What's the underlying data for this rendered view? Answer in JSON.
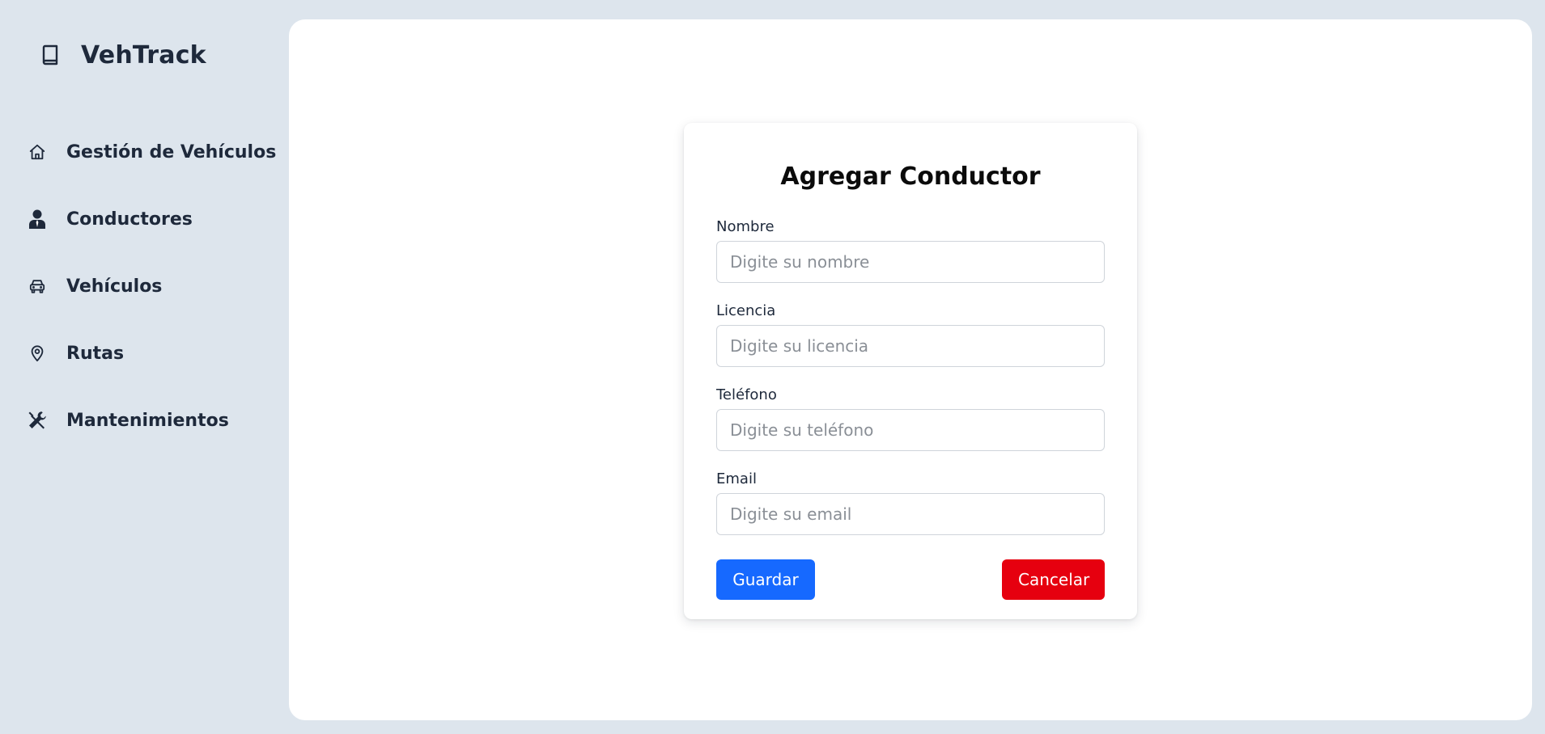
{
  "brand": {
    "title": "VehTrack",
    "icon": "book-icon"
  },
  "sidebar": {
    "items": [
      {
        "label": "Gestión de Vehículos",
        "icon": "home-icon"
      },
      {
        "label": "Conductores",
        "icon": "user-icon"
      },
      {
        "label": "Vehículos",
        "icon": "car-icon"
      },
      {
        "label": "Rutas",
        "icon": "map-pin-icon"
      },
      {
        "label": "Mantenimientos",
        "icon": "tools-icon"
      }
    ]
  },
  "form": {
    "title": "Agregar Conductor",
    "fields": [
      {
        "label": "Nombre",
        "value": "",
        "placeholder": "Digite su nombre"
      },
      {
        "label": "Licencia",
        "value": "",
        "placeholder": "Digite su licencia"
      },
      {
        "label": "Teléfono",
        "value": "",
        "placeholder": "Digite su teléfono"
      },
      {
        "label": "Email",
        "value": "",
        "placeholder": "Digite su email"
      }
    ],
    "save_label": "Guardar",
    "cancel_label": "Cancelar"
  },
  "colors": {
    "background": "#dde5ed",
    "text": "#1e293b",
    "save": "#1669ff",
    "cancel": "#e6000f"
  }
}
